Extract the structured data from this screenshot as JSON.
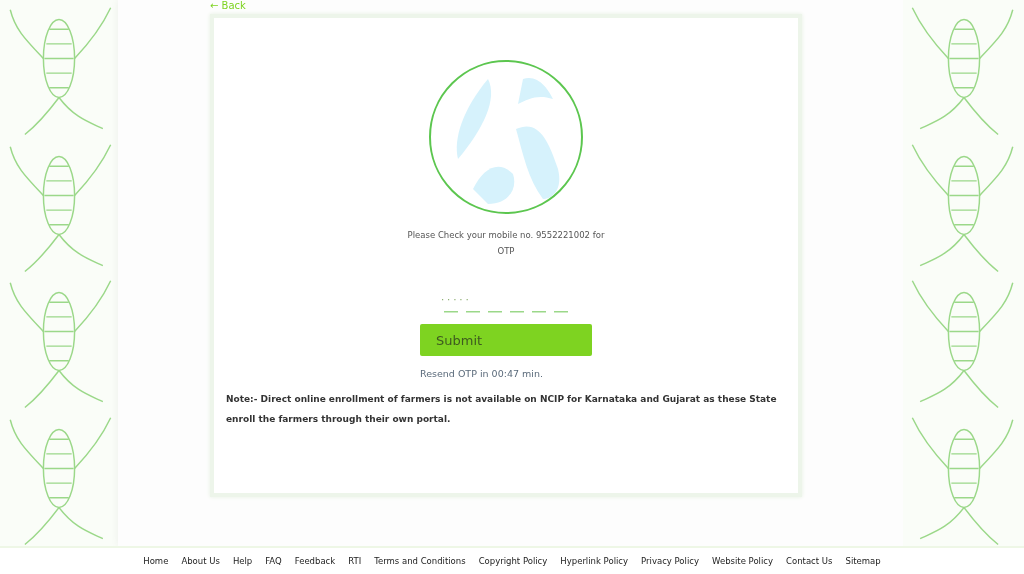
{
  "back_link": "← Back",
  "otp_card": {
    "message": "Please Check your mobile no. 9552221002 for OTP",
    "otp_field": {
      "placeholder": "· · · · ·"
    },
    "submit": "Submit",
    "resend": "Resend OTP in 00:47 min.",
    "note": "Note:- Direct online enrollment of farmers is not available on NCIP for Karnataka and Gujarat as these State enroll the farmers through their own portal."
  },
  "footer_links": [
    "Home",
    "About Us",
    "Help",
    "FAQ",
    "Feedback",
    "RTI",
    "Terms and Conditions",
    "Copyright Policy",
    "Hyperlink Policy",
    "Privacy Policy",
    "Website Policy",
    "Contact Us",
    "Sitemap"
  ]
}
